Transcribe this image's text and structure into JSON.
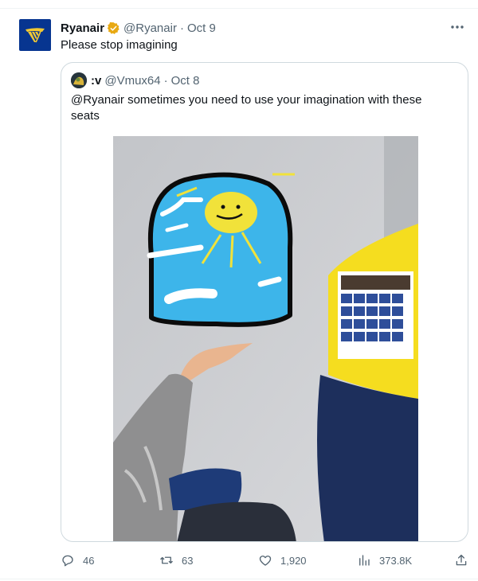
{
  "tweet": {
    "author_name": "Ryanair",
    "author_handle": "@Ryanair",
    "separator": "·",
    "date": "Oct 9",
    "text": "Please stop imagining"
  },
  "quote": {
    "author_name": ":v",
    "author_handle": "@Vmux64",
    "separator": "·",
    "date": "Oct 8",
    "text": "@Ryanair sometimes you need to use your imagination with these seats"
  },
  "actions": {
    "replies": "46",
    "retweets": "63",
    "likes": "1,920",
    "views": "373.8K"
  },
  "colors": {
    "brand": "#073590",
    "verified": "#e8a913",
    "text": "#0f1419",
    "muted": "#536471",
    "border": "#cfd9de"
  },
  "icons": [
    "ryanair-harp-logo",
    "verified-badge-icon",
    "more-icon",
    "reply-icon",
    "retweet-icon",
    "like-icon",
    "views-icon",
    "share-icon"
  ]
}
